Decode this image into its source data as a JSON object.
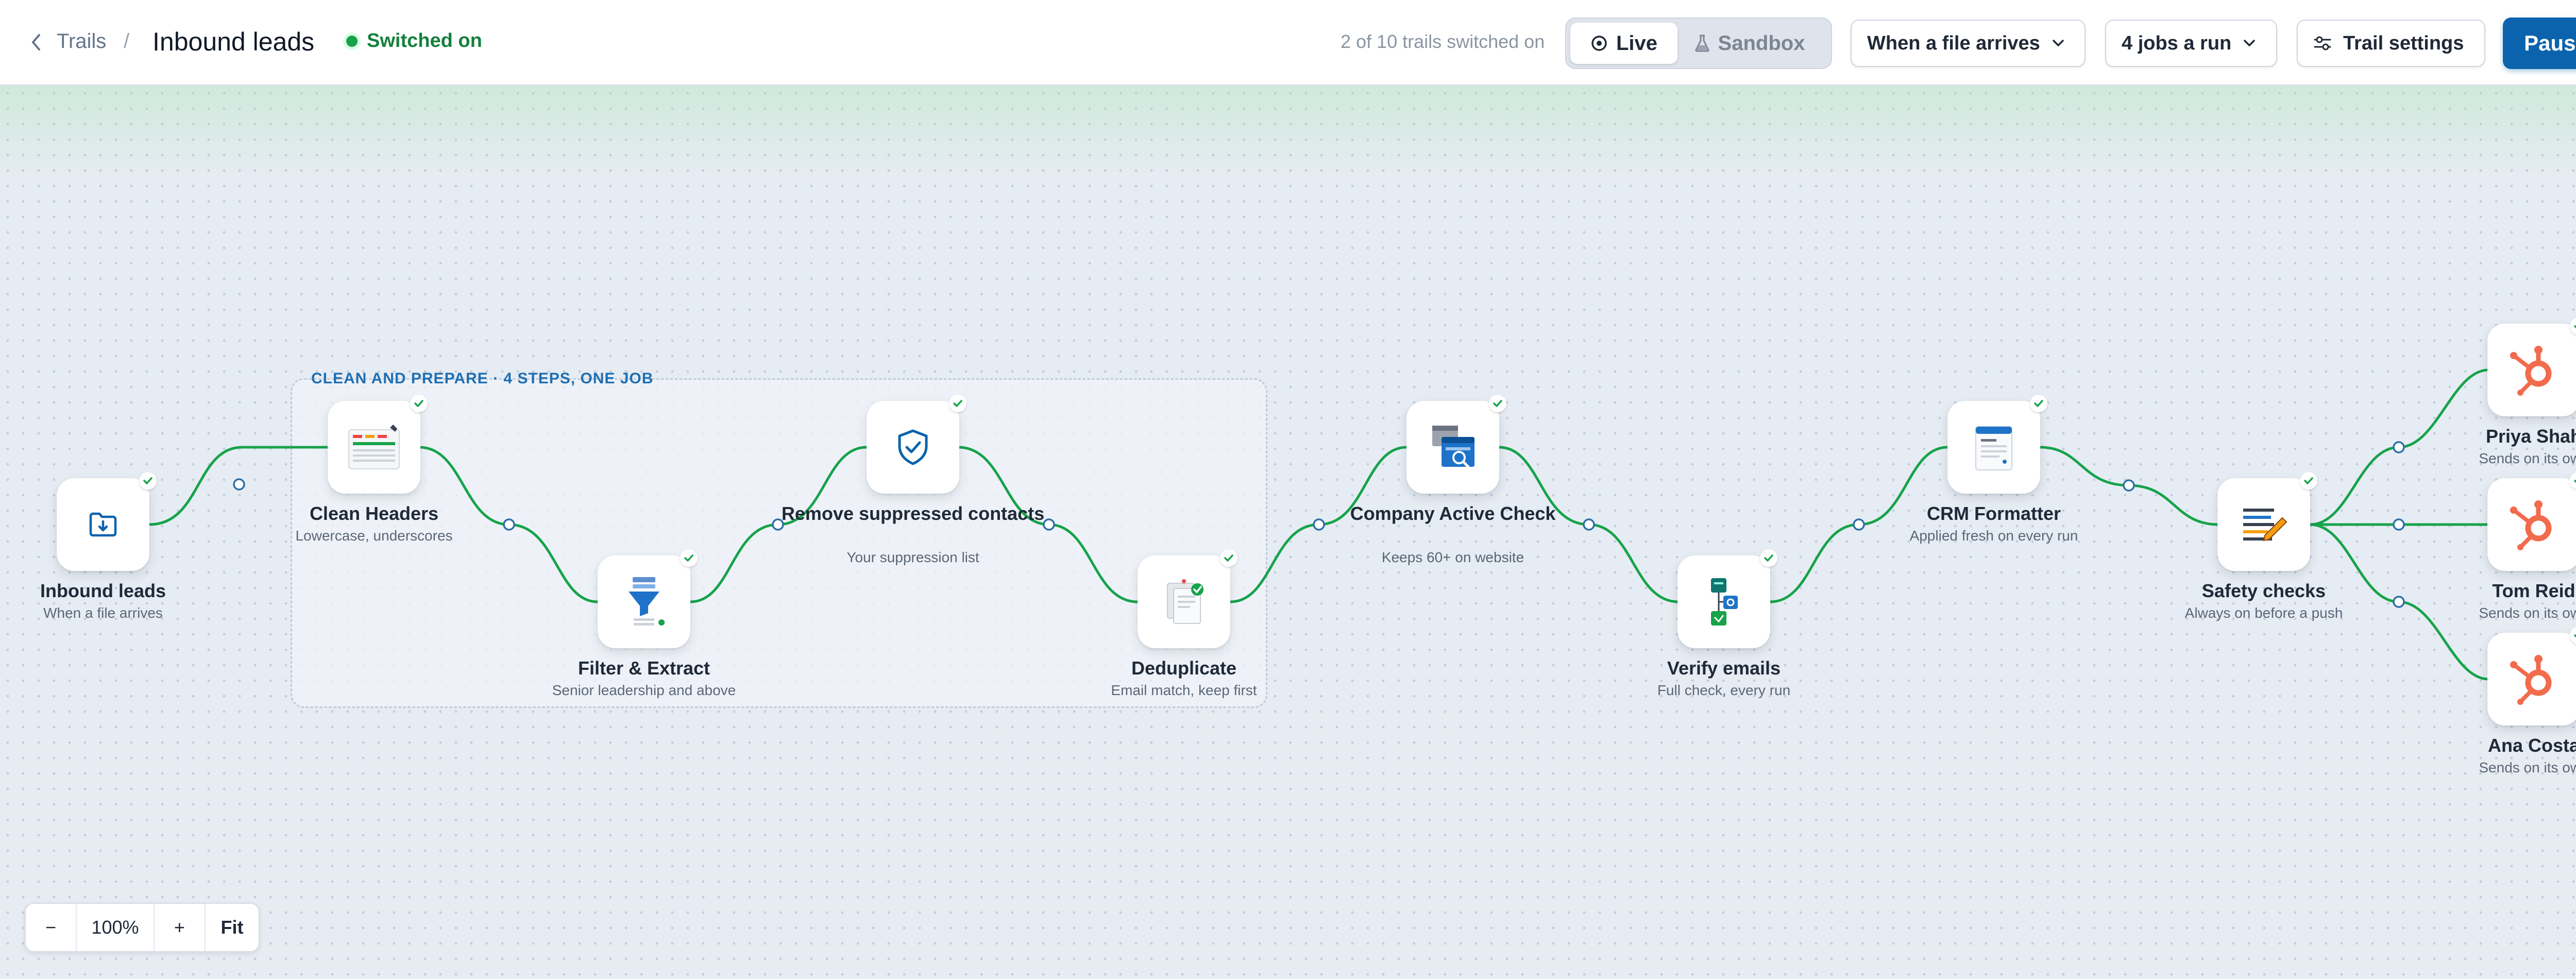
{
  "header": {
    "back_label": "Trails",
    "separator": "/",
    "title": "Inbound leads",
    "status": "Switched on",
    "trail_count": "2 of 10 trails switched on",
    "mode_live": "Live",
    "mode_sandbox": "Sandbox",
    "trigger": "When a file arrives",
    "jobs": "4 jobs a run",
    "settings": "Trail settings",
    "pause": "Pause"
  },
  "group": {
    "label": "CLEAN AND PREPARE · 4 STEPS, ONE JOB"
  },
  "nodes": [
    {
      "name": "Inbound leads",
      "sub": "When a file arrives",
      "icon": "folder-download-icon"
    },
    {
      "name": "Clean Headers",
      "sub": "Lowercase, underscores",
      "icon": "table-header-icon"
    },
    {
      "name": "Filter & Extract",
      "sub": "Senior leadership and above",
      "icon": "funnel-icon"
    },
    {
      "name": "Remove suppressed contacts",
      "sub": "Your suppression list",
      "icon": "shield-check-icon"
    },
    {
      "name": "Deduplicate",
      "sub": "Email match, keep first",
      "icon": "documents-icon"
    },
    {
      "name": "Company Active Check",
      "sub": "Keeps 60+ on website",
      "icon": "browser-search-icon"
    },
    {
      "name": "Verify emails",
      "sub": "Full check, every run",
      "icon": "email-verify-icon"
    },
    {
      "name": "CRM Formatter",
      "sub": "Applied fresh on every run",
      "icon": "form-document-icon"
    },
    {
      "name": "Safety checks",
      "sub": "Always on before a push",
      "icon": "checklist-pencil-icon"
    },
    {
      "name": "Priya Shah",
      "sub": "Sends on its own",
      "icon": "hubspot-icon"
    },
    {
      "name": "Tom Reid",
      "sub": "Sends on its own",
      "icon": "hubspot-icon"
    },
    {
      "name": "Ana Costa",
      "sub": "Sends on its own",
      "icon": "hubspot-icon"
    }
  ],
  "zoom": {
    "minus": "−",
    "level": "100%",
    "plus": "+",
    "fit": "Fit"
  },
  "colors": {
    "accent": "#0b63ad",
    "wire": "#16a34a",
    "status": "#15803d",
    "hubspot": "#f26b4d"
  }
}
